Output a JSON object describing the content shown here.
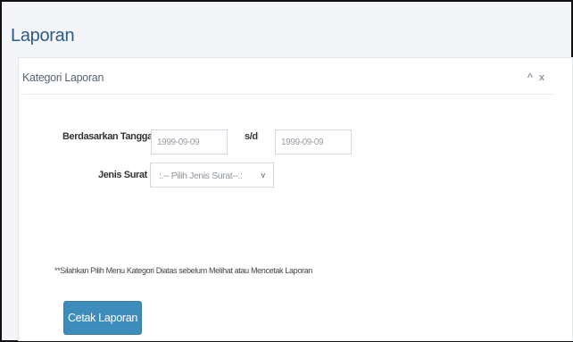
{
  "page": {
    "title": "Laporan"
  },
  "panel": {
    "title": "Kategori Laporan",
    "tools": {
      "collapse_icon": "chevron-up-icon",
      "collapse_glyph": "^",
      "close_icon": "close-icon",
      "close_glyph": "x"
    }
  },
  "form": {
    "date_label": "Berdasarkan Tanggal",
    "date_start_placeholder": "1999-09-09",
    "range_separator": "s/d",
    "date_end_placeholder": "1999-09-09",
    "jenis_label": "Jenis Surat",
    "jenis_selected": ":.-- Pilih Jenis Surat--.:",
    "jenis_arrow_glyph": "v"
  },
  "note": "**Silahkan Pilih Menu Kategori Diatas sebelum Melihat atau Mencetak Laporan",
  "actions": {
    "print_label": "Cetak Laporan"
  },
  "colors": {
    "accent": "#3c8dbc",
    "title": "#2e5a87"
  }
}
